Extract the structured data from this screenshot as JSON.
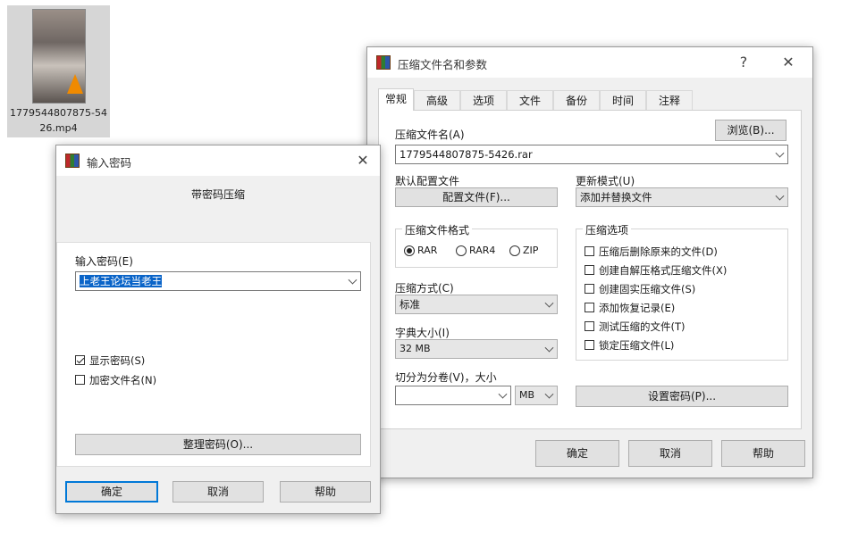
{
  "desktop": {
    "file_name": "1779544807875-5426.mp4"
  },
  "archive_dialog": {
    "title": "压缩文件名和参数",
    "help_button": "?",
    "close_button": "✕",
    "tabs": [
      "常规",
      "高级",
      "选项",
      "文件",
      "备份",
      "时间",
      "注释"
    ],
    "archive_name_label": "压缩文件名(A)",
    "browse_button": "浏览(B)...",
    "archive_name_value": "1779544807875-5426.rar",
    "default_profile_label": "默认配置文件",
    "profile_button": "配置文件(F)...",
    "update_mode_label": "更新模式(U)",
    "update_mode_value": "添加并替换文件",
    "archive_format_label": "压缩文件格式",
    "formats": [
      "RAR",
      "RAR4",
      "ZIP"
    ],
    "selected_format": "RAR",
    "compression_method_label": "压缩方式(C)",
    "compression_method_value": "标准",
    "dictionary_size_label": "字典大小(I)",
    "dictionary_size_value": "32 MB",
    "split_label": "切分为分卷(V)，大小",
    "split_value": "",
    "split_unit": "MB",
    "options_label": "压缩选项",
    "options": [
      {
        "label": "压缩后删除原来的文件(D)",
        "checked": false
      },
      {
        "label": "创建自解压格式压缩文件(X)",
        "checked": false
      },
      {
        "label": "创建固实压缩文件(S)",
        "checked": false
      },
      {
        "label": "添加恢复记录(E)",
        "checked": false
      },
      {
        "label": "测试压缩的文件(T)",
        "checked": false
      },
      {
        "label": "锁定压缩文件(L)",
        "checked": false
      }
    ],
    "set_password_button": "设置密码(P)...",
    "ok_button": "确定",
    "cancel_button": "取消",
    "help_bottom_button": "帮助"
  },
  "password_dialog": {
    "title": "输入密码",
    "close_button": "✕",
    "subtitle": "带密码压缩",
    "password_label": "输入密码(E)",
    "password_value": "上老王论坛当老王",
    "show_password_label": "显示密码(S)",
    "show_password_checked": true,
    "encrypt_names_label": "加密文件名(N)",
    "encrypt_names_checked": false,
    "organize_button": "整理密码(O)...",
    "ok_button": "确定",
    "cancel_button": "取消",
    "help_button": "帮助"
  },
  "colors": {
    "accent": "#0078d7",
    "selection": "#0a64c8",
    "dialog_bg": "#f0f0f0"
  }
}
